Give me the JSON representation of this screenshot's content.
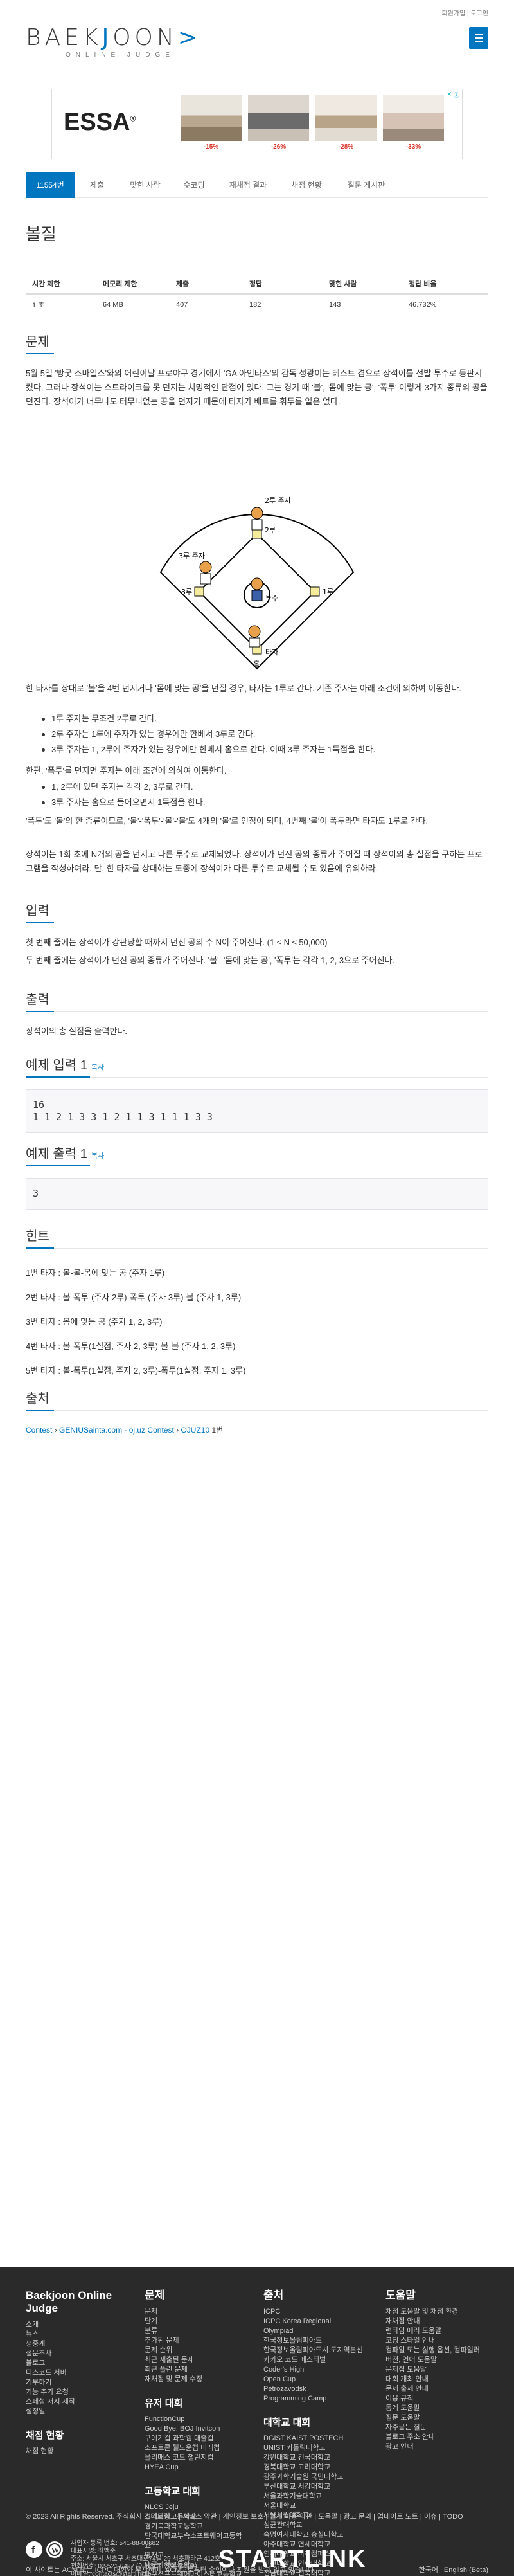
{
  "header": {
    "top_links": [
      "회원가입",
      "로그인"
    ],
    "logo_part1": "BAEK",
    "logo_k": "J",
    "logo_part2": "OON",
    "logo_arrow": ">",
    "logo_sub": "ONLINE JUDGE"
  },
  "ad": {
    "brand": "ESSA",
    "brand_mark": "®",
    "discounts": [
      "-15%",
      "-26%",
      "-28%",
      "-33%"
    ]
  },
  "tabs": [
    "11554번",
    "제출",
    "맞힌 사람",
    "숏코딩",
    "재채점 결과",
    "채점 현황",
    "질문 게시판"
  ],
  "problem": {
    "title": "볼질",
    "stats_headers": [
      "시간 제한",
      "메모리 제한",
      "제출",
      "정답",
      "맞힌 사람",
      "정답 비율"
    ],
    "stats_values": [
      "1 초",
      "64 MB",
      "407",
      "182",
      "143",
      "46.732%"
    ],
    "description_heading": "문제",
    "description_p1": "5월 5일 '방굿 스마일스'와의 어린이날 프로야구 경기에서 'GA 아인타즈'의 감독 성광이는 테스트 겸으로 장석이를 선발 투수로 등판시켰다. 그러나 장석이는 스트라이크를 못 던지는 치명적인 단점이 있다. 그는 경기 때 '볼', '몸에 맞는 공', '폭투' 이렇게 3가지 종류의 공을 던진다. 장석이가 너무나도 터무니없는 공을 던지기 때문에 타자가 배트를 휘두를 일은 없다.",
    "field_labels": {
      "second_base": "2루 주자",
      "third_runner": "3루 주자",
      "second": "2루",
      "third": "3루",
      "pitcher": "투수",
      "first": "1루",
      "home": "홈",
      "hitter": "타자"
    },
    "description_p2": "한 타자를 상대로 '볼'을 4번 던지거나 '몸에 맞는 공'을 던질 경우, 타자는 1루로 간다. 기존 주자는 아래 조건에 의하여 이동한다.",
    "rules_walk": [
      "1루 주자는 무조건 2루로 간다.",
      "2루 주자는 1루에 주자가 있는 경우에만 한베서 3루로 간다.",
      "3루 주자는 1, 2루에 주자가 있는 경우에만 한베서 홈으로 간다. 이때 3루 주자는 1득점을 한다."
    ],
    "description_p3": "한편, '폭투'를 던지면 주자는 아래 조건에 의하여 이동한다.",
    "rules_wild": [
      "1, 2루에 있던 주자는 각각 2, 3루로 간다.",
      "3루 주자는 홈으로 들어오면서 1득점을 한다."
    ],
    "description_p4": "'폭투'도 '볼'의 한 종류이므로, '볼'-'폭투'-'볼'-'볼'도 4개의 '볼'로 인정이 되며, 4번째 '볼'이 폭투라면 타자도 1루로 간다.",
    "description_p5": "장석이는 1회 초에 N개의 공을 던지고 다른 투수로 교체되었다. 장석이가 던진 공의 종류가 주어질 때 장석이의 총 실점을 구하는 프로그램을 작성하여라. 단, 한 타자를 상대하는 도중에 장석이가 다른 투수로 교체될 수도 있음에 유의하라.",
    "input_heading": "입력",
    "input_p1": "첫 번째 줄에는 장석이가 강판당할 때까지 던진 공의 수 N이 주어진다. (1 ≤ N ≤ 50,000)",
    "input_p2": "두 번째 줄에는 장석이가 던진 공의 종류가 주어진다. '볼', '몸에 맞는 공', '폭투'는 각각 1, 2, 3으로 주어진다.",
    "output_heading": "출력",
    "output_p1": "장석이의 총 실점을 출력한다.",
    "sample_input_heading": "예제 입력 1",
    "sample_output_heading": "예제 출력 1",
    "copy_label": "복사",
    "sample_input_line1": "16",
    "sample_input_line2": "1 1 2 1 3 3 1 2 1 1 3 1 1 1 3 3",
    "sample_output": "3",
    "hint_heading": "힌트",
    "hints": [
      "1번 타자 : 볼-볼-몸에 맞는 공 (주자 1루)",
      "2번 타자 : 볼-폭투-(주자 2루)-폭투-(주자 3루)-볼 (주자 1, 3루)",
      "3번 타자 : 몸에 맞는 공 (주자 1, 2, 3루)",
      "4번 타자 : 볼-폭투(1실점, 주자 2, 3루)-볼-볼 (주자 1, 2, 3루)",
      "5번 타자 : 볼-폭투(1실점, 주자 2, 3루)-폭투(1실점, 주자 1, 3루)"
    ],
    "source_heading": "출처",
    "source_parts": [
      "Contest",
      "GENIUSainta.com - oj.uz Contest",
      "OJUZ10"
    ],
    "source_suffix": "1번"
  },
  "footer": {
    "col1_title": "Baekjoon Online Judge",
    "col1_items": [
      "소개",
      "뉴스",
      "생중계",
      "설문조사",
      "블로그",
      "디스코드 서버",
      "기부하기",
      "기능 추가 요청",
      "스페셜 저지 제작",
      "설정일"
    ],
    "col1_sub": "채점 현황",
    "col1_sub_items": [
      "채점 현황"
    ],
    "col2_title": "문제",
    "col2_items": [
      "문제",
      "단계",
      "분류",
      "추가된 문제",
      "문제 순위",
      "최근 제출된 문제",
      "최근 풀린 문제",
      "재채점 및 문제 수정"
    ],
    "col2_sub": "유저 대회",
    "col2_sub_items": [
      "FunctionCup",
      "Good Bye, BOJ Invitcon",
      "구데기컵 과학캠 대출컵",
      "소프트콘 웰노운컵 미래컵",
      "올리매스 코드 챌린지컵",
      "HYEA Cup"
    ],
    "col2_sub2": "고등학교 대회",
    "col2_sub2_items": [
      "NLCS Jeju",
      "경기과학고등학교",
      "경기북과학고등학교",
      "단국대학교부속소프트웨어고등학교",
      "영재고",
      "대구과학고등학교",
      "대구소프트웨어마이스터고등학교",
      "동래고등학교 부산과학고",
      "서울과학고등학교",
      "선린인터넷고등학교",
      "세종과학예술영재학교",
      "송도고등학교",
      "한국과학영재학교"
    ],
    "col3_title": "출처",
    "col3_items": [
      "ICPC",
      "ICPC Korea Regional",
      "Olympiad",
      "한국정보올림피아드",
      "한국정보올림피아드시.도지역본선",
      "카카오 코드 페스티벌",
      "Coder's High",
      "Open Cup",
      "Petrozavodsk",
      "Programming Camp"
    ],
    "col3_sub": "대학교 대회",
    "col3_sub_items": [
      "DGIST KAIST POSTECH UNIST 카톨릭대학교",
      "강원대학교 건국대학교",
      "경북대학교 고려대학교",
      "광주과학기술원 국민대학교",
      "부산대학교 서강대학교",
      "서울과학기술대학교",
      "서울대학교",
      "서울시립대학교",
      "성균관대학교",
      "숙명여자대학교 숭실대학교",
      "아주대학교 연세대학교",
      "연세대학교 미래캠퍼스",
      "인천대학교 인하대학교",
      "전남대학교 전북대학교",
      "제주대학교 중앙대학교",
      "충남대학교 한국항공대학교",
      "한양대학교",
      "한양대학교 ERICA 캠퍼스",
      "홍익대학교",
      "경인지역 6개대학 연합 프로그래밍 경시대회",
      "전국 대학생 프로그래밍 대회 동아리 연합"
    ],
    "col4_title": "도움말",
    "col4_items": [
      "채점 도움말 및 채점 환경",
      "재채점 안내",
      "런타임 에러 도움말",
      "코딩 스타일 안내",
      "컴파일 또는 실행 옵션, 컴파일러 버전, 언어 도움말",
      "문제집 도움말",
      "대회 개최 안내",
      "문제 출제 안내",
      "이용 규칙",
      "통계 도움말",
      "질문 도움말",
      "자주묻는 질문",
      "블로그 주소 안내",
      "광고 안내"
    ],
    "copyright_line1": "© 2023 All Rights Reserved. 주식회사 스타트링크",
    "copyright_links": [
      "서비스 약관",
      "개인정보 보호",
      "결제 이용 약관",
      "도움말",
      "광고 문의",
      "업데이트 노트",
      "이슈",
      "TODO"
    ],
    "biz_lines": [
      "사업자 등록 번호: 541-88-00682",
      "대표자명: 최백준",
      "주소: 서울시 서초구 서초대로74길 29 서초파라곤 412호",
      "전화번호: 02-521-0487 (이메일로 연락 주세요)",
      "이메일: contacts@startlink.io",
      "통신판매신고번호: 제 2017-서울서초-2193 호"
    ],
    "startlink": "STARTLINK",
    "bottom_note": "이 사이트는 ACM 또는 ICPC 대회와 무관하며, ACM으로부터 승인이나 지원을 받지 않고 있습니다.",
    "lang": "한국어 | English (Beta)"
  }
}
